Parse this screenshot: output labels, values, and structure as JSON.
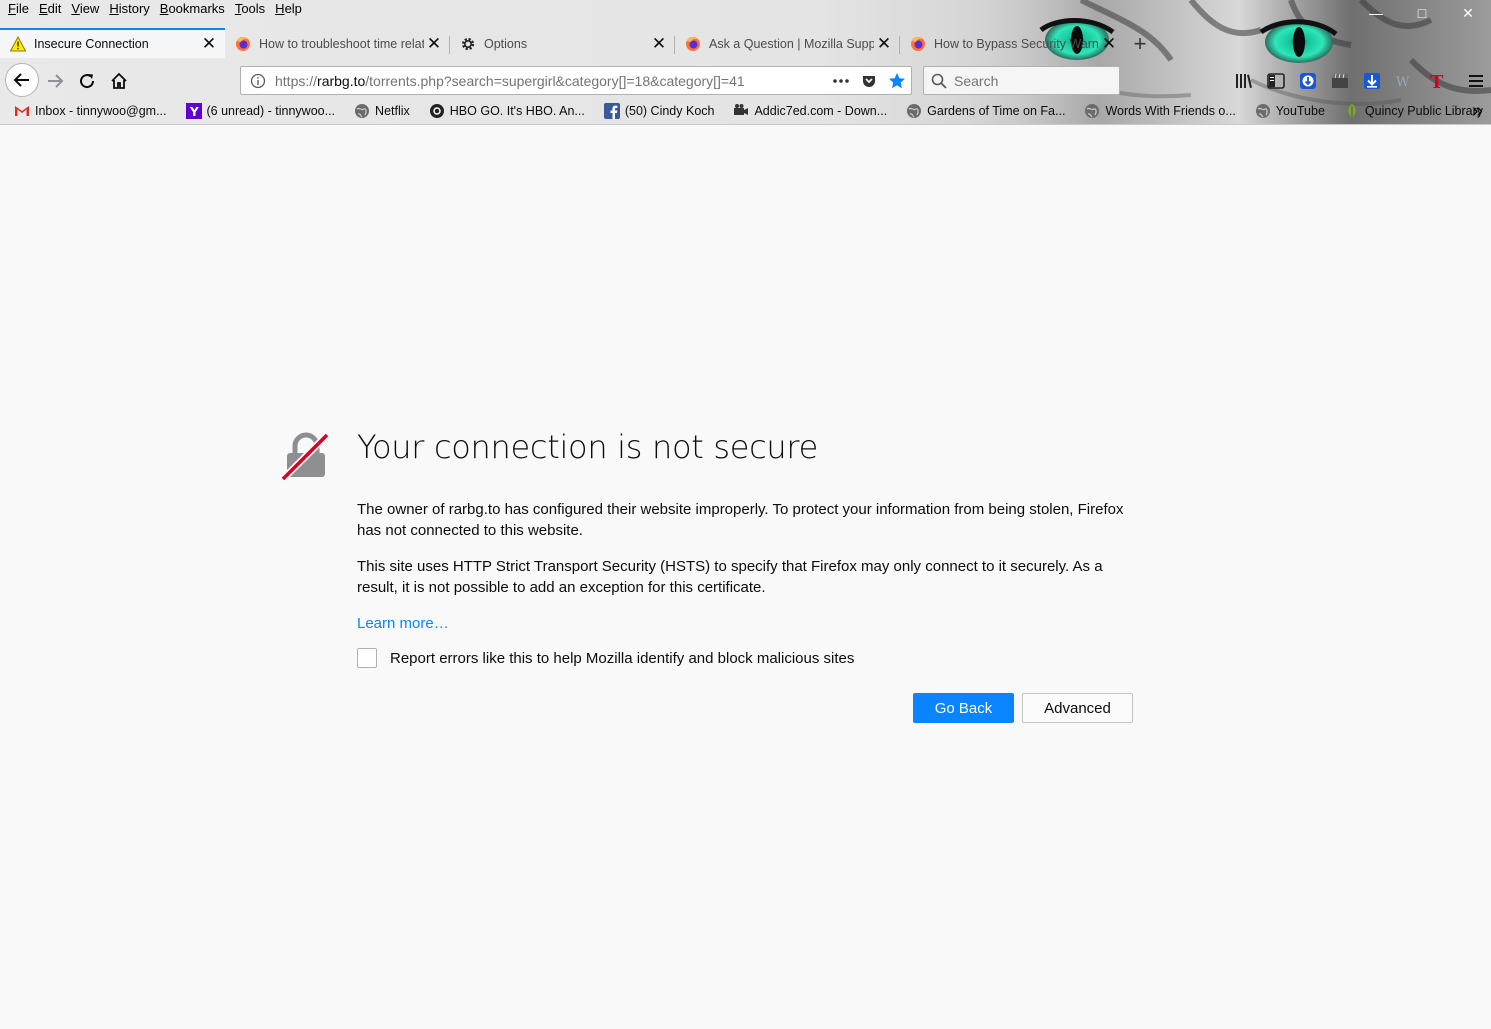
{
  "menubar": {
    "items": [
      {
        "underline": "F",
        "rest": "ile"
      },
      {
        "underline": "E",
        "rest": "dit"
      },
      {
        "underline": "V",
        "rest": "iew"
      },
      {
        "underline": "H",
        "rest": "istory"
      },
      {
        "underline": "B",
        "rest": "ookmarks"
      },
      {
        "underline": "T",
        "rest": "ools"
      },
      {
        "underline": "H",
        "rest": "elp"
      }
    ]
  },
  "tabs": [
    {
      "title": "Insecure Connection",
      "icon": "warning-icon",
      "selected": true
    },
    {
      "title": "How to troubleshoot time related",
      "icon": "firefox-icon"
    },
    {
      "title": "Options",
      "icon": "gear-icon"
    },
    {
      "title": "Ask a Question | Mozilla Support",
      "icon": "firefox-icon"
    },
    {
      "title": "How to Bypass Security Warn",
      "icon": "firefox-icon"
    }
  ],
  "urlbar": {
    "scheme": "https://",
    "host": "rarbg.to",
    "path": "/torrents.php?search=supergirl&category[]=18&category[]=41"
  },
  "search": {
    "placeholder": "Search"
  },
  "bookmarks": [
    {
      "label": "Inbox - tinnywoo@gm...",
      "icon": "gmail-icon"
    },
    {
      "label": "(6 unread) - tinnywoo...",
      "icon": "yahoo-icon"
    },
    {
      "label": "Netflix",
      "icon": "globe-icon"
    },
    {
      "label": "HBO GO. It's HBO. An...",
      "icon": "hbo-icon"
    },
    {
      "label": "(50) Cindy Koch",
      "icon": "facebook-icon"
    },
    {
      "label": "Addic7ed.com - Down...",
      "icon": "addic7ed-icon"
    },
    {
      "label": "Gardens of Time on Fa...",
      "icon": "globe-icon"
    },
    {
      "label": "Words With Friends o...",
      "icon": "globe-icon"
    },
    {
      "label": "YouTube",
      "icon": "globe-icon"
    },
    {
      "label": "Quincy Public Library",
      "icon": "library-icon"
    }
  ],
  "error": {
    "title": "Your connection is not secure",
    "paragraph1": "The owner of rarbg.to has configured their website improperly. To protect your information from being stolen, Firefox has not connected to this website.",
    "paragraph2": "This site uses HTTP Strict Transport Security (HSTS) to specify that Firefox may only connect to it securely. As a result, it is not possible to add an exception for this certificate.",
    "learn_more": "Learn more…",
    "report_label": "Report errors like this to help Mozilla identify and block malicious sites",
    "go_back": "Go Back",
    "advanced": "Advanced"
  },
  "colors": {
    "accent": "#0a84ff",
    "page_bg": "#f9f9fa",
    "warning_slash": "#d70022"
  }
}
